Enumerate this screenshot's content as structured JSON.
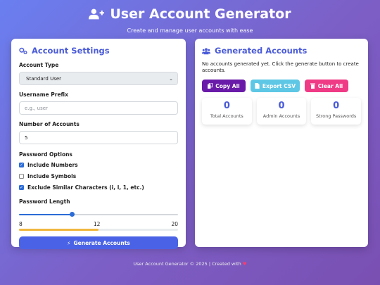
{
  "header": {
    "title": "User Account Generator",
    "subtitle": "Create and manage user accounts with ease",
    "icon": "user-plus-icon"
  },
  "settings": {
    "title": "Account Settings",
    "icon": "gears-icon",
    "account_type": {
      "label": "Account Type",
      "selected": "Standard User"
    },
    "username_prefix": {
      "label": "Username Prefix",
      "placeholder": "e.g., user"
    },
    "num_accounts": {
      "label": "Number of Accounts",
      "value": "5"
    },
    "password_options": {
      "label": "Password Options",
      "options": [
        {
          "label": "Include Numbers",
          "checked": true
        },
        {
          "label": "Include Symbols",
          "checked": false
        },
        {
          "label": "Exclude Similar Characters (i, l, 1, etc.)",
          "checked": true
        }
      ]
    },
    "password_length": {
      "label": "Password Length",
      "min": "8",
      "value": "12",
      "max": "20",
      "strength_fraction": 0.5,
      "strength_color": "#f0b73e"
    },
    "generate_button": "Generate Accounts"
  },
  "generated": {
    "title": "Generated Accounts",
    "icon": "users-icon",
    "empty_message": "No accounts generated yet. Click the generate button to create accounts.",
    "buttons": {
      "copy": "Copy All",
      "export": "Export CSV",
      "clear": "Clear All"
    },
    "stats": [
      {
        "value": "0",
        "label": "Total Accounts"
      },
      {
        "value": "0",
        "label": "Admin Accounts"
      },
      {
        "value": "0",
        "label": "Strong Passwords"
      }
    ]
  },
  "footer": {
    "text": "User Account Generator © 2025 | Created with",
    "heart": "♥"
  },
  "colors": {
    "accent": "#4a5bd8",
    "primary_button": "#4a63e6",
    "copy_button": "#6a1aa8",
    "export_button": "#5ec7e6",
    "clear_button": "#ef3a86"
  }
}
